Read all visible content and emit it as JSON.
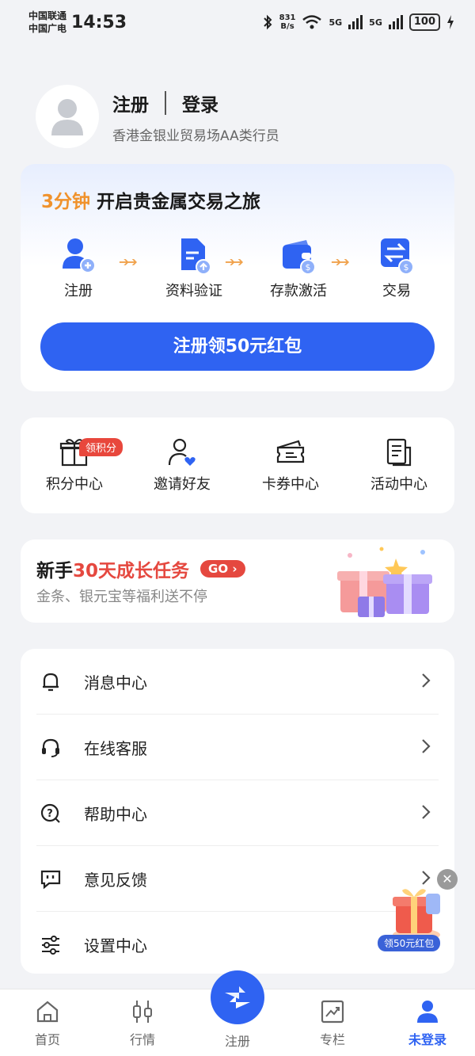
{
  "status_bar": {
    "carrier_1": "中国联通",
    "carrier_2": "中国广电",
    "time": "14:53",
    "speed_value": "831",
    "speed_unit": "B/s",
    "net_1": "5G",
    "net_2": "5G",
    "battery": "100"
  },
  "profile": {
    "register_label": "注册",
    "login_label": "登录",
    "subtitle": "香港金银业贸易场AA类行员"
  },
  "journey": {
    "title_highlight": "3分钟",
    "title_rest": "开启贵金属交易之旅",
    "steps": [
      "注册",
      "资料验证",
      "存款激活",
      "交易"
    ],
    "cta": "注册领50元红包"
  },
  "quick_entries": {
    "badge": "领积分",
    "items": [
      "积分中心",
      "邀请好友",
      "卡券中心",
      "活动中心"
    ]
  },
  "growth": {
    "title_prefix": "新手",
    "title_highlight": "30天成长任务",
    "go_label": "GO",
    "subtitle": "金条、银元宝等福利送不停"
  },
  "menu": {
    "items": [
      "消息中心",
      "在线客服",
      "帮助中心",
      "意见反馈",
      "设置中心"
    ]
  },
  "floating": {
    "label": "领50元红包"
  },
  "bottom_nav": {
    "items": [
      "首页",
      "行情",
      "注册",
      "专栏",
      "未登录"
    ],
    "active_index": 4
  },
  "colors": {
    "primary": "#2f63f2",
    "accent_orange": "#f0922c",
    "accent_red": "#e5483f"
  }
}
